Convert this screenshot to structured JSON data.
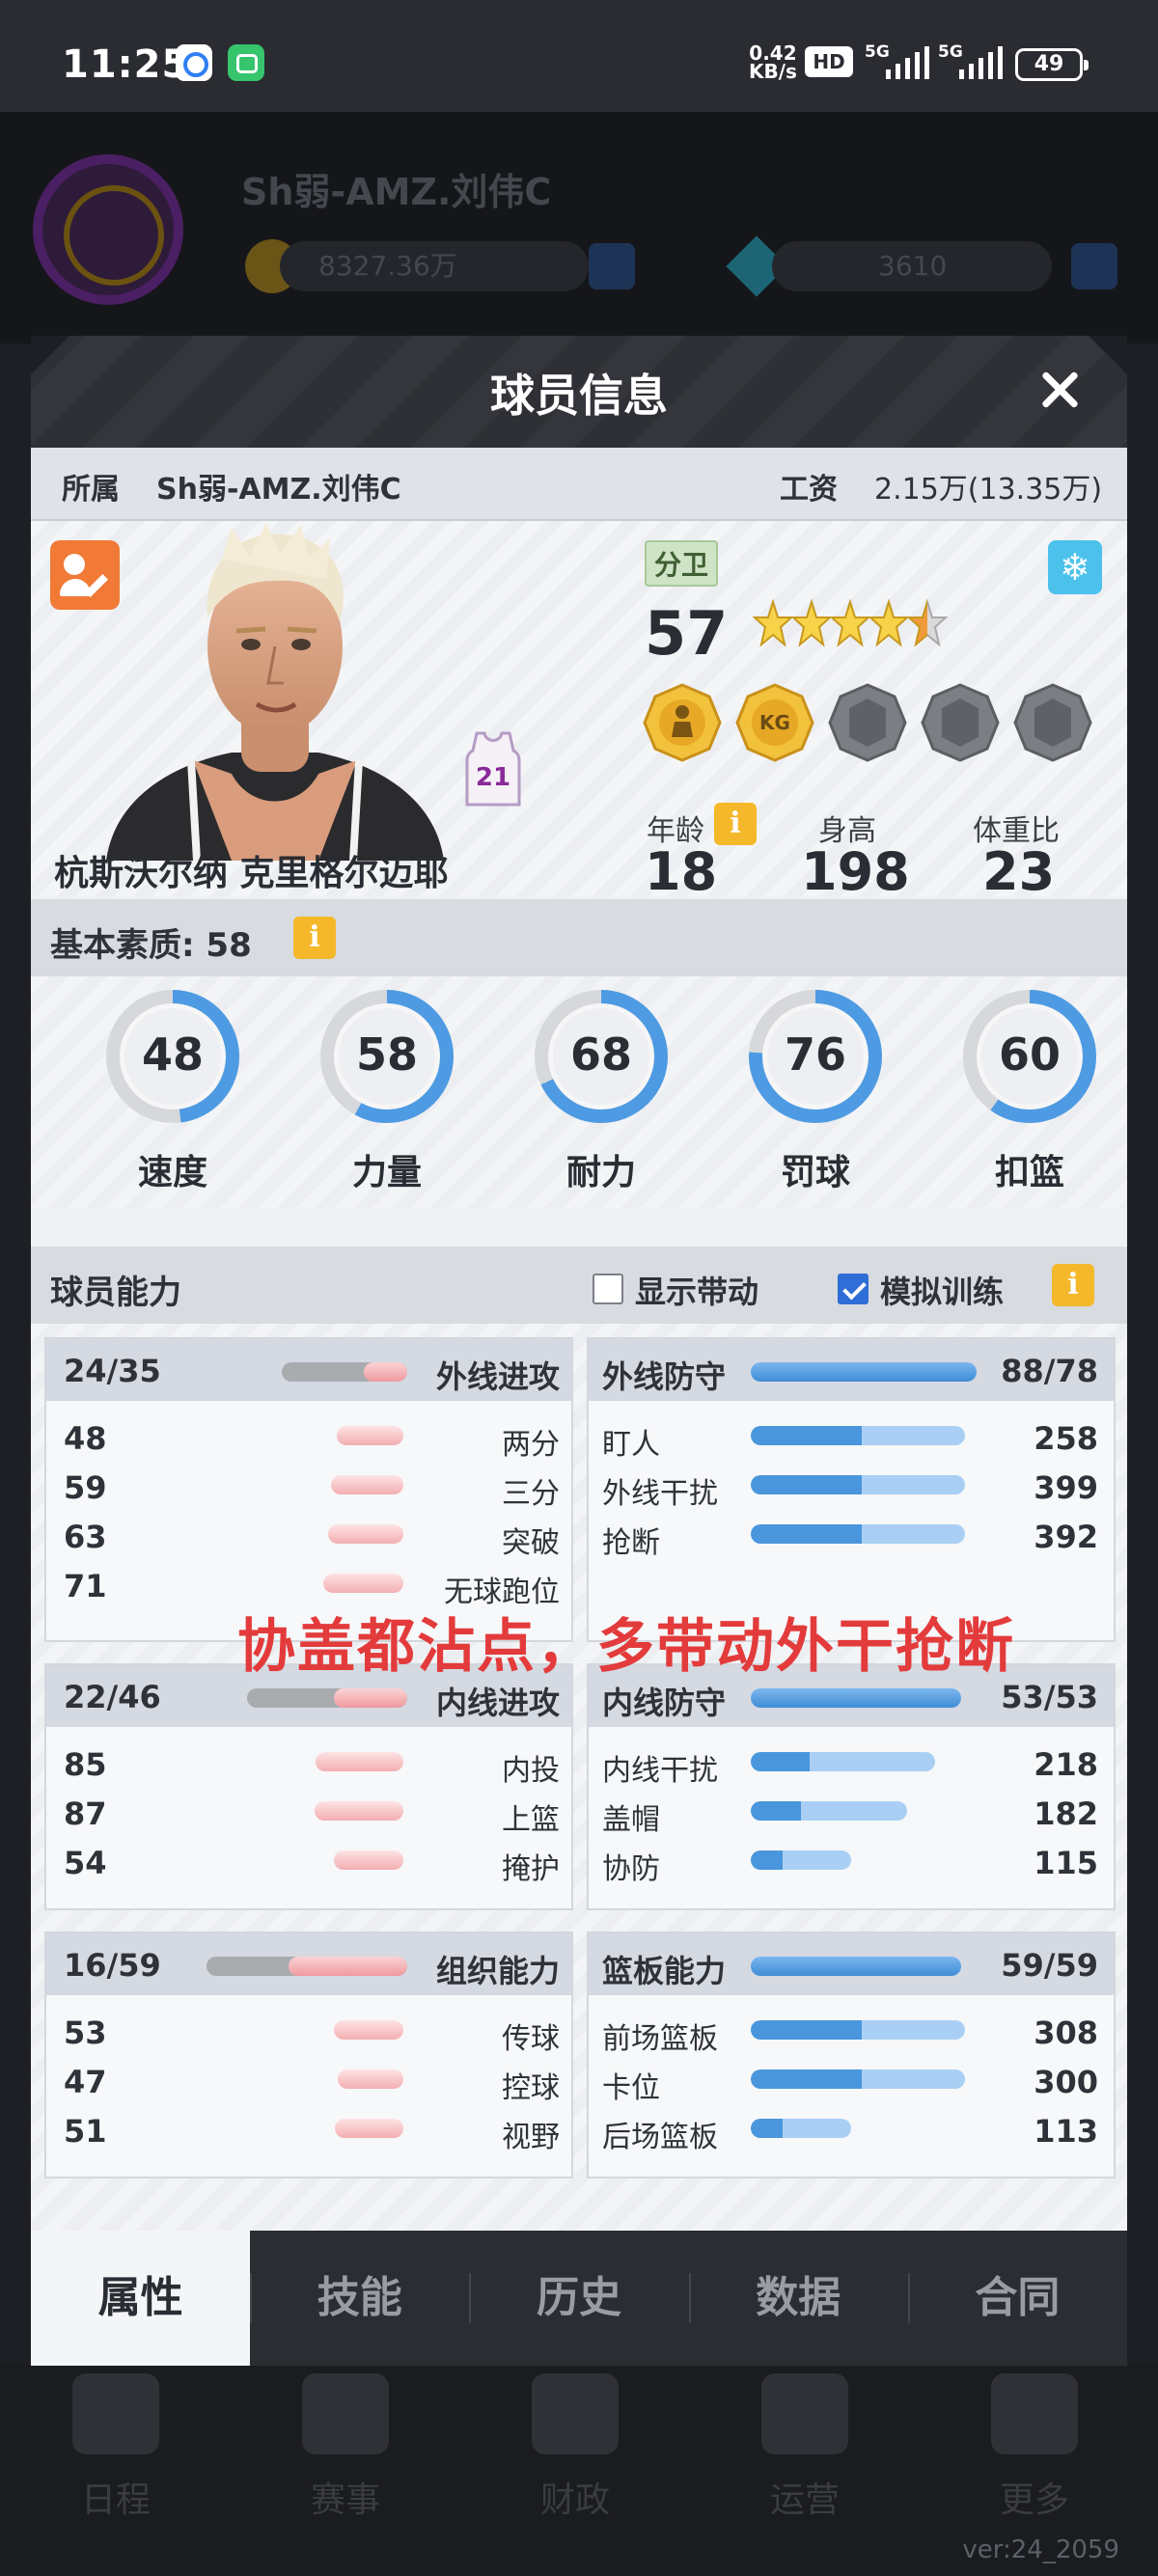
{
  "status_bar": {
    "time": "11:25",
    "speed_value": "0.42",
    "speed_unit": "KB/s",
    "hd_label": "HD",
    "network": [
      "5G",
      "5G"
    ],
    "battery": "49",
    "icons": [
      "app-notification-icon",
      "app-notification-icon-2",
      "signal-icon",
      "battery-icon"
    ]
  },
  "background": {
    "team_name": "Sh弱-AMZ.刘伟C",
    "coins": "8327.36万",
    "gems": "3610"
  },
  "dialog": {
    "title": "球员信息",
    "close_icon": "close-icon",
    "team_label": "所属",
    "team_value": "Sh弱-AMZ.刘伟C",
    "salary_label": "工资",
    "salary_value": "2.15万(13.35万)"
  },
  "player": {
    "name": "杭斯沃尔纳 克里格尔迈耶",
    "position": "分卫",
    "overall": "57",
    "stars": 4.5,
    "jersey_number": "21",
    "age_label": "年龄",
    "age": "18",
    "height_label": "身高",
    "height": "198",
    "weight_label": "体重比",
    "weight": "23",
    "badges": [
      {
        "icon": "player-badge-icon",
        "active": true
      },
      {
        "icon": "kg-badge-icon",
        "active": true,
        "text": "KG"
      },
      {
        "icon": "empty-badge-icon",
        "active": false
      },
      {
        "icon": "empty-badge-icon",
        "active": false
      },
      {
        "icon": "empty-badge-icon",
        "active": false
      }
    ]
  },
  "basic_quality": {
    "label": "基本素质: 58",
    "gauges": [
      {
        "label": "速度",
        "value": "48",
        "fill": 0.48
      },
      {
        "label": "力量",
        "value": "58",
        "fill": 0.58
      },
      {
        "label": "耐力",
        "value": "68",
        "fill": 0.68
      },
      {
        "label": "罚球",
        "value": "76",
        "fill": 0.76
      },
      {
        "label": "扣篮",
        "value": "60",
        "fill": 0.6
      }
    ]
  },
  "abilities": {
    "label": "球员能力",
    "show_drive_label": "显示带动",
    "show_drive_checked": false,
    "simulate_label": "模拟训练",
    "simulate_checked": true,
    "groups": [
      {
        "name": "外线进攻",
        "score": "24/35",
        "side": "left",
        "color": "red",
        "fill": 0.35,
        "rows": [
          {
            "name": "两分",
            "value": "48",
            "fill": 0.48
          },
          {
            "name": "三分",
            "value": "59",
            "fill": 0.59
          },
          {
            "name": "突破",
            "value": "63",
            "fill": 0.63
          },
          {
            "name": "无球跑位",
            "value": "71",
            "fill": 0.71
          }
        ]
      },
      {
        "name": "外线防守",
        "score": "88/78",
        "side": "right",
        "color": "blue",
        "fill": 1.0,
        "rows": [
          {
            "name": "盯人",
            "value": "258",
            "fill": 1.0
          },
          {
            "name": "外线干扰",
            "value": "399",
            "fill": 1.0
          },
          {
            "name": "抢断",
            "value": "392",
            "fill": 1.0
          }
        ]
      },
      {
        "name": "内线进攻",
        "score": "22/46",
        "side": "left",
        "color": "red",
        "fill": 0.46,
        "rows": [
          {
            "name": "内投",
            "value": "85",
            "fill": 0.85
          },
          {
            "name": "上篮",
            "value": "87",
            "fill": 0.87
          },
          {
            "name": "掩护",
            "value": "54",
            "fill": 0.54
          }
        ]
      },
      {
        "name": "内线防守",
        "score": "53/53",
        "side": "right",
        "color": "blue",
        "fill": 1.0,
        "rows": [
          {
            "name": "内线干扰",
            "value": "218",
            "fill": 0.86
          },
          {
            "name": "盖帽",
            "value": "182",
            "fill": 0.73
          },
          {
            "name": "协防",
            "value": "115",
            "fill": 0.47
          }
        ]
      },
      {
        "name": "组织能力",
        "score": "16/59",
        "side": "left",
        "color": "red",
        "fill": 0.59,
        "rows": [
          {
            "name": "传球",
            "value": "53",
            "fill": 0.53
          },
          {
            "name": "控球",
            "value": "47",
            "fill": 0.47
          },
          {
            "name": "视野",
            "value": "51",
            "fill": 0.51
          }
        ]
      },
      {
        "name": "篮板能力",
        "score": "59/59",
        "side": "right",
        "color": "blue",
        "fill": 1.0,
        "rows": [
          {
            "name": "前场篮板",
            "value": "308",
            "fill": 1.0
          },
          {
            "name": "卡位",
            "value": "300",
            "fill": 1.0
          },
          {
            "name": "后场篮板",
            "value": "113",
            "fill": 0.47
          }
        ]
      }
    ]
  },
  "overlay_note": "协盖都沾点，多带动外干抢断",
  "tabs": [
    {
      "label": "属性",
      "active": true
    },
    {
      "label": "技能",
      "active": false
    },
    {
      "label": "历史",
      "active": false
    },
    {
      "label": "数据",
      "active": false
    },
    {
      "label": "合同",
      "active": false
    }
  ],
  "bottom_nav": [
    "日程",
    "赛事",
    "财政",
    "运营",
    "更多"
  ],
  "version": "ver:24_2059",
  "colors": {
    "dialog_header": "#2e3035",
    "accent_blue": "#3d8fd8",
    "accent_red": "#f3a5a8",
    "info_yellow": "#f5b82a",
    "note_red": "#e33b3b"
  }
}
